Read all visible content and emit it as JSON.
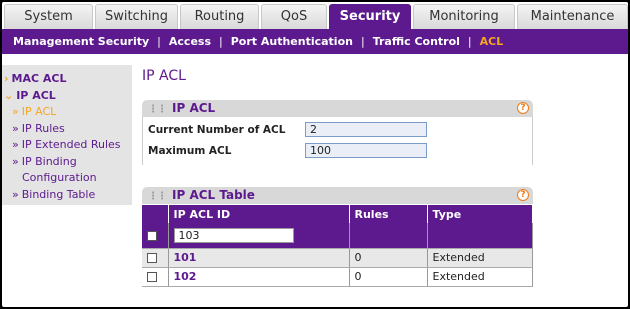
{
  "tabs": [
    {
      "label": "System"
    },
    {
      "label": "Switching"
    },
    {
      "label": "Routing"
    },
    {
      "label": "QoS"
    },
    {
      "label": "Security"
    },
    {
      "label": "Monitoring"
    },
    {
      "label": "Maintenance"
    }
  ],
  "active_tab": "Security",
  "subnav": [
    "Management Security",
    "Access",
    "Port Authentication",
    "Traffic Control",
    "ACL"
  ],
  "active_subnav": "ACL",
  "sidebar": {
    "mac_acl": "MAC ACL",
    "ip_acl": "IP ACL",
    "items": [
      "IP ACL",
      "IP Rules",
      "IP Extended Rules",
      "IP Binding",
      "Configuration",
      "Binding Table"
    ]
  },
  "page_title": "IP ACL",
  "panel1": {
    "title": "IP ACL",
    "current_label": "Current Number of ACL",
    "current_value": "2",
    "max_label": "Maximum ACL",
    "max_value": "100"
  },
  "panel2": {
    "title": "IP ACL Table",
    "columns": [
      "IP ACL ID",
      "Rules",
      "Type"
    ],
    "input_value": "103",
    "rows": [
      {
        "id": "101",
        "rules": "0",
        "type": "Extended"
      },
      {
        "id": "102",
        "rules": "0",
        "type": "Extended"
      }
    ]
  },
  "help_glyph": "?",
  "colors": {
    "brand": "#5c1a8e",
    "accent": "#f5a623",
    "panel_header": "#d8d8d8"
  }
}
